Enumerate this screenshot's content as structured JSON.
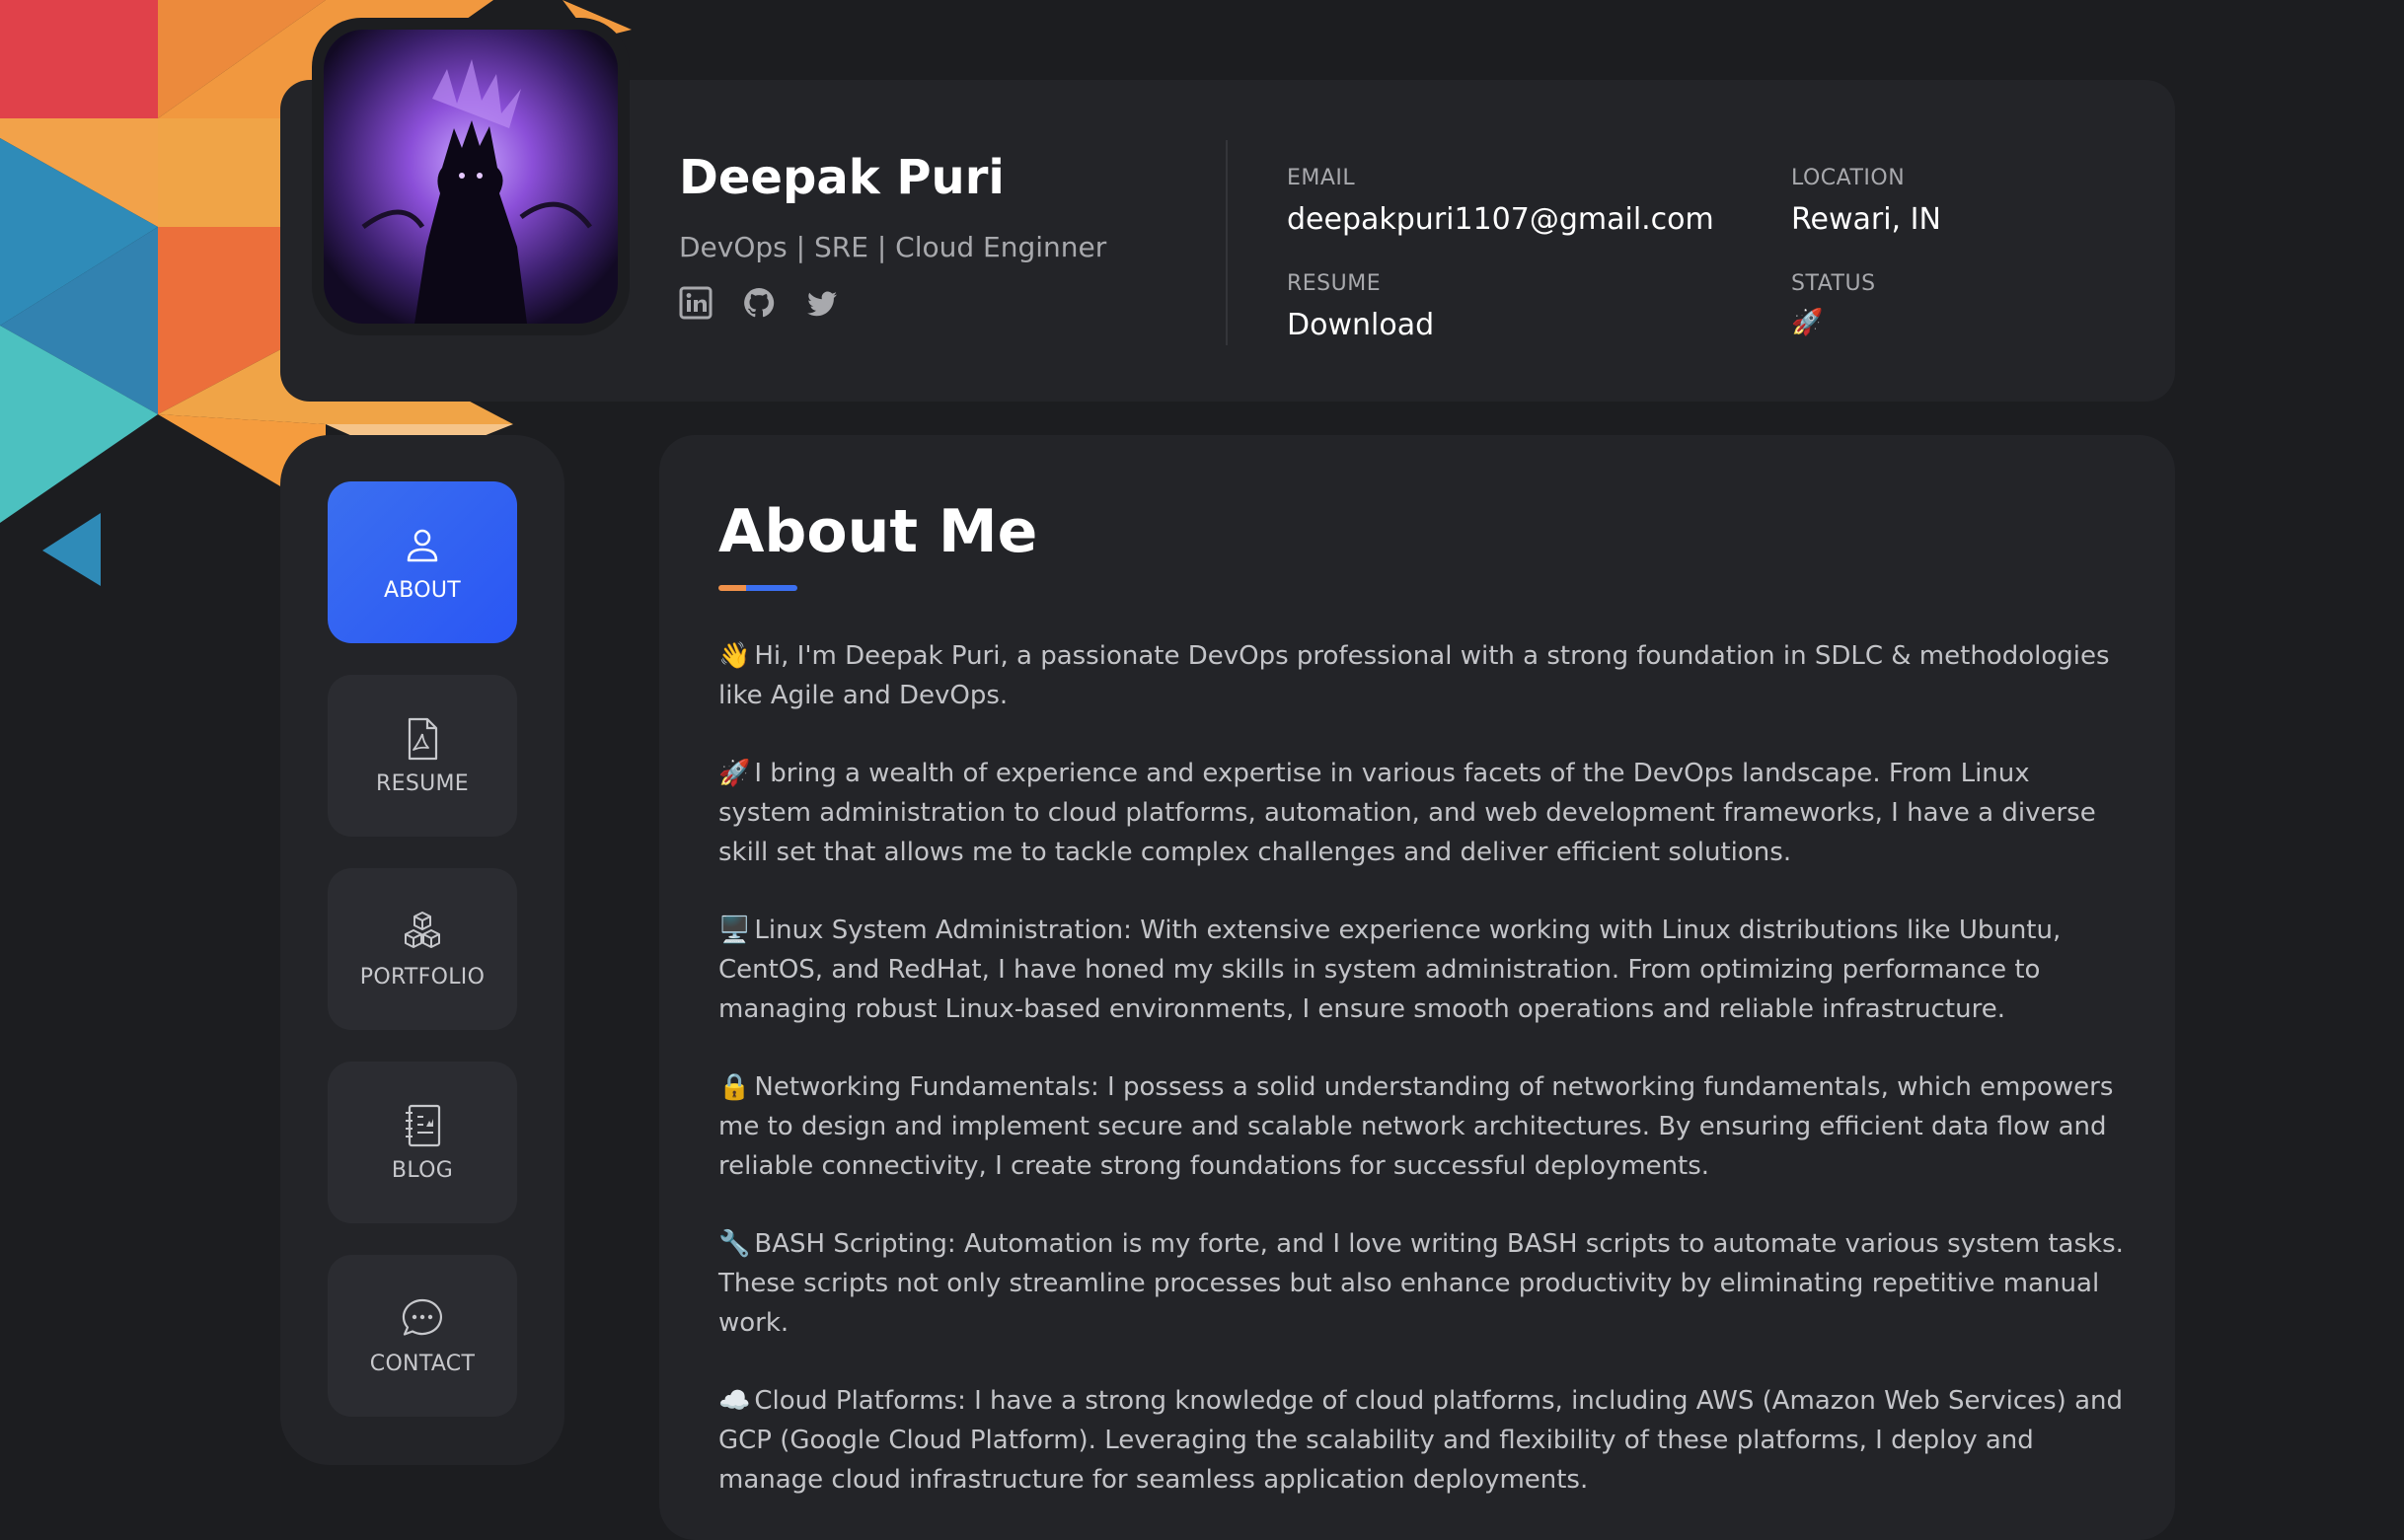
{
  "profile": {
    "name": "Deepak Puri",
    "role": "DevOps | SRE | Cloud Enginner",
    "socials": [
      {
        "name": "linkedin",
        "icon": "linkedin-icon"
      },
      {
        "name": "github",
        "icon": "github-icon"
      },
      {
        "name": "twitter",
        "icon": "twitter-icon"
      }
    ]
  },
  "info": {
    "email_label": "EMAIL",
    "email_value": "deepakpuri1107@gmail.com",
    "location_label": "LOCATION",
    "location_value": "Rewari, IN",
    "resume_label": "RESUME",
    "resume_value": "Download",
    "status_label": "STATUS",
    "status_value": "🚀"
  },
  "nav": {
    "items": [
      {
        "label": "ABOUT",
        "icon": "user-icon",
        "active": true
      },
      {
        "label": "RESUME",
        "icon": "pdf-file-icon",
        "active": false
      },
      {
        "label": "PORTFOLIO",
        "icon": "cubes-icon",
        "active": false
      },
      {
        "label": "BLOG",
        "icon": "journal-icon",
        "active": false
      },
      {
        "label": "CONTACT",
        "icon": "chat-bubble-icon",
        "active": false
      }
    ]
  },
  "about": {
    "title": "About Me",
    "paragraphs": [
      {
        "emoji": "👋",
        "text": "Hi, I'm Deepak Puri, a passionate DevOps professional with a strong foundation in SDLC & methodologies like Agile and DevOps."
      },
      {
        "emoji": "🚀",
        "text": "I bring a wealth of experience and expertise in various facets of the DevOps landscape. From Linux system administration to cloud platforms, automation, and web development frameworks, I have a diverse skill set that allows me to tackle complex challenges and deliver efficient solutions."
      },
      {
        "emoji": "🖥️",
        "text": "Linux System Administration: With extensive experience working with Linux distributions like Ubuntu, CentOS, and RedHat, I have honed my skills in system administration. From optimizing performance to managing robust Linux-based environments, I ensure smooth operations and reliable infrastructure."
      },
      {
        "emoji": "🔒",
        "text": "Networking Fundamentals: I possess a solid understanding of networking fundamentals, which empowers me to design and implement secure and scalable network architectures. By ensuring efficient data flow and reliable connectivity, I create strong foundations for successful deployments."
      },
      {
        "emoji": "🔧",
        "text": "BASH Scripting: Automation is my forte, and I love writing BASH scripts to automate various system tasks. These scripts not only streamline processes but also enhance productivity by eliminating repetitive manual work."
      },
      {
        "emoji": "☁️",
        "text": "Cloud Platforms: I have a strong knowledge of cloud platforms, including AWS (Amazon Web Services) and GCP (Google Cloud Platform). Leveraging the scalability and flexibility of these platforms, I deploy and manage cloud infrastructure for seamless application deployments."
      }
    ]
  },
  "colors": {
    "accent_blue": "#2f5ff2",
    "accent_orange": "#f0914a",
    "card_bg": "#232428",
    "page_bg": "#1c1d20"
  }
}
